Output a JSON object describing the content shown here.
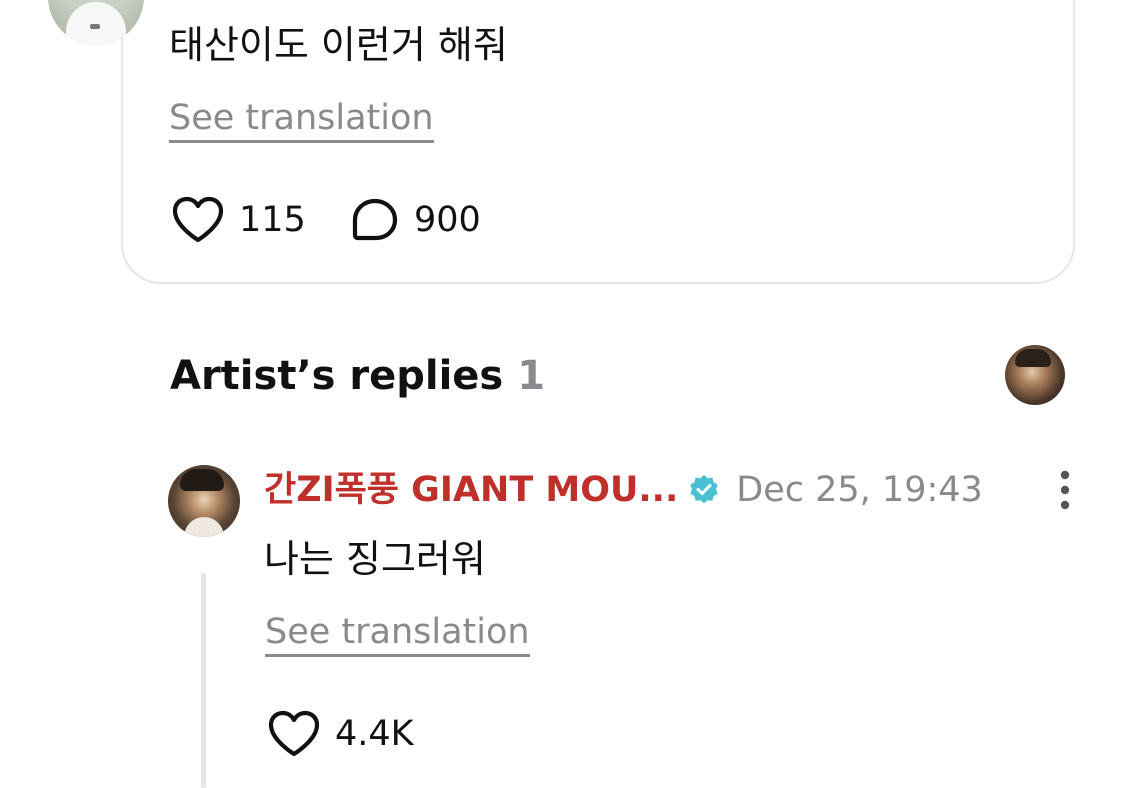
{
  "post": {
    "text": "태산이도 이런거 해줘",
    "see_translation": "See translation",
    "likes": "115",
    "comments": "900"
  },
  "artist_replies": {
    "title": "Artist’s replies",
    "count": "1",
    "reply": {
      "author": "간ZI폭풍 GIANT MOU...",
      "verified": true,
      "date": "Dec 25, 19:43",
      "text": "나는 징그러워",
      "see_translation": "See translation",
      "likes": "4.4K"
    }
  },
  "colors": {
    "author_name": "#c0302b",
    "verified_badge": "#4cc0d3",
    "muted_text": "#8a8a8e",
    "card_border": "#e6e6e8",
    "thread_line": "#e5e5ea"
  },
  "icons": {
    "like": "heart-icon",
    "comment": "speech-bubble-icon",
    "verified": "verified-check-icon",
    "menu": "more-vertical-icon"
  }
}
